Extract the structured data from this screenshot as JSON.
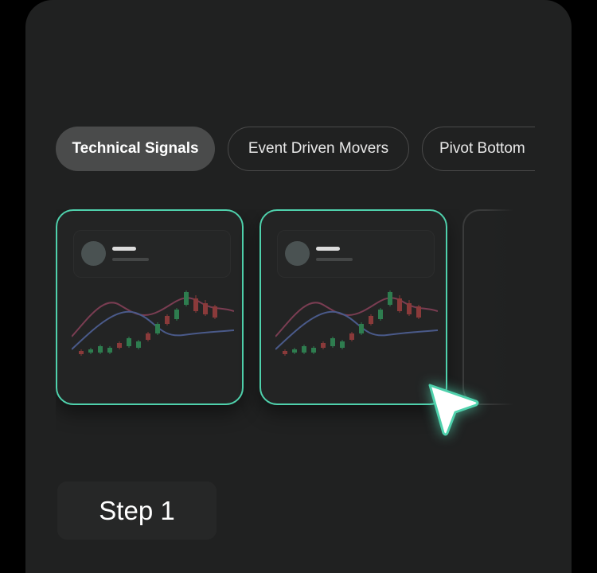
{
  "tabs": [
    {
      "label": "Technical Signals",
      "active": true
    },
    {
      "label": "Event Driven Movers",
      "active": false
    },
    {
      "label": "Pivot Bottom",
      "active": false
    }
  ],
  "cards": [
    {
      "selected": true,
      "thumbnail": "candlestick-chart-preview"
    },
    {
      "selected": true,
      "thumbnail": "candlestick-chart-preview"
    },
    {
      "selected": false,
      "thumbnail": "partially-visible-card"
    }
  ],
  "step": {
    "label": "Step 1"
  },
  "cursor": {
    "icon": "pointer-arrow-icon"
  },
  "colors": {
    "background": "#202121",
    "accent": "#4fd1ac",
    "active_tab": "#4a4b4b",
    "candle_up": "#2e7d4f",
    "candle_down": "#8a3a3a",
    "line_red": "#7a3d52",
    "line_blue": "#4a5a8a"
  }
}
